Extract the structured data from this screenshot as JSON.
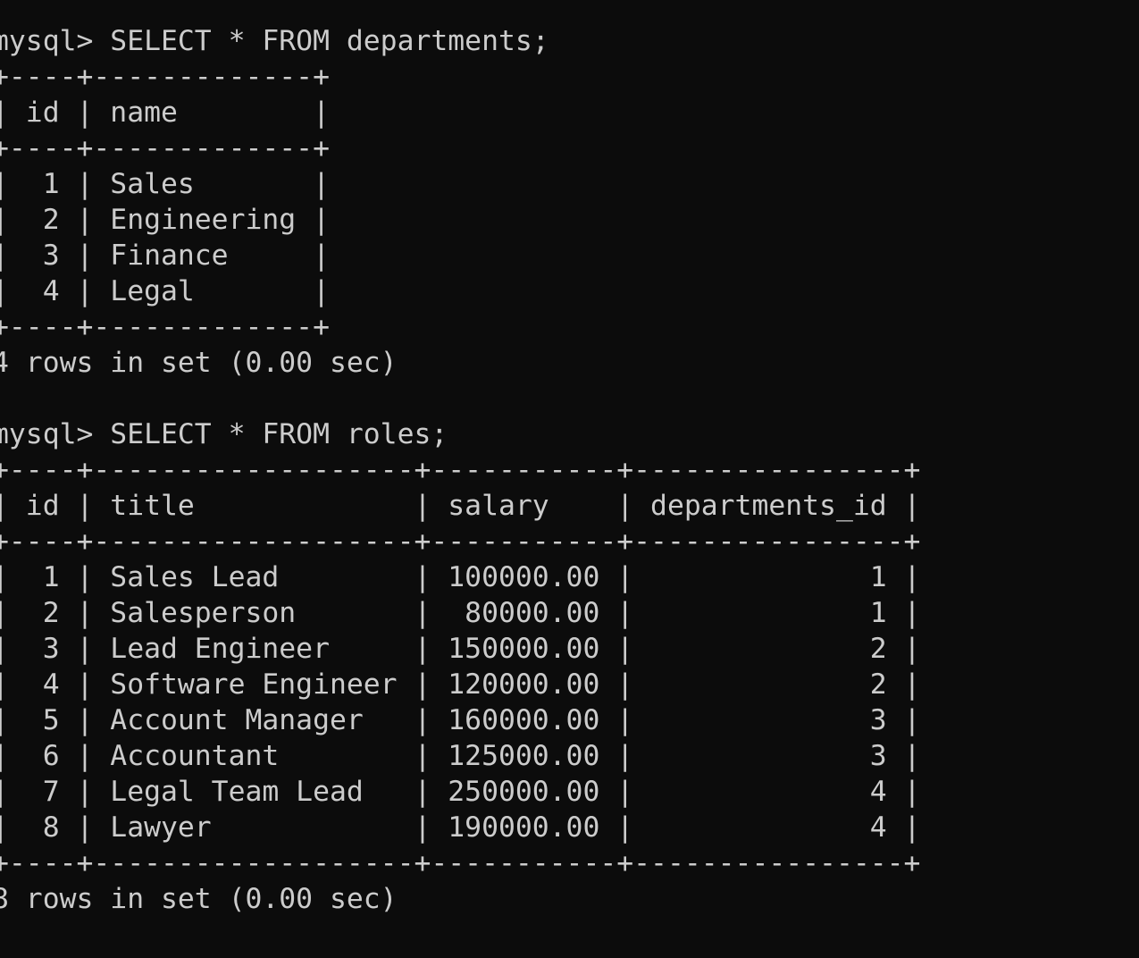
{
  "terminal": {
    "foreground": "#cccccc",
    "background": "#0c0c0c",
    "lines": [
      "mysql> SELECT * FROM departments;",
      "+----+-------------+",
      "| id | name        |",
      "+----+-------------+",
      "|  1 | Sales       |",
      "|  2 | Engineering |",
      "|  3 | Finance     |",
      "|  4 | Legal       |",
      "+----+-------------+",
      "4 rows in set (0.00 sec)",
      "",
      "mysql> SELECT * FROM roles;",
      "+----+-------------------+-----------+----------------+",
      "| id | title             | salary    | departments_id |",
      "+----+-------------------+-----------+----------------+",
      "|  1 | Sales Lead        | 100000.00 |              1 |",
      "|  2 | Salesperson       |  80000.00 |              1 |",
      "|  3 | Lead Engineer     | 150000.00 |              2 |",
      "|  4 | Software Engineer | 120000.00 |              2 |",
      "|  5 | Account Manager   | 160000.00 |              3 |",
      "|  6 | Accountant        | 125000.00 |              3 |",
      "|  7 | Legal Team Lead   | 250000.00 |              4 |",
      "|  8 | Lawyer            | 190000.00 |              4 |",
      "+----+-------------------+-----------+----------------+",
      "8 rows in set (0.00 sec)"
    ]
  }
}
